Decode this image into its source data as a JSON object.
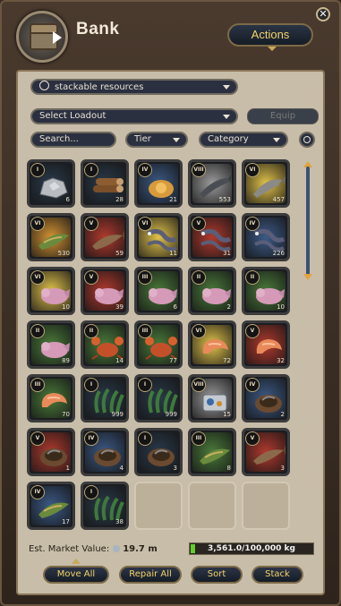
{
  "header": {
    "title": "Bank",
    "actions_label": "Actions",
    "close_label": "✕"
  },
  "filters": {
    "resource_dropdown": "stackable resources",
    "loadout_dropdown": "Select Loadout",
    "equip_label": "Equip",
    "search_value": "Search...",
    "tier_dropdown": "Tier",
    "category_dropdown": "Category"
  },
  "inventory": [
    {
      "tier": "I",
      "count": "6",
      "kind": "stone",
      "color": "#2a3a4a"
    },
    {
      "tier": "I",
      "count": "28",
      "kind": "log",
      "color": "#2a3a4a"
    },
    {
      "tier": "IV",
      "count": "21",
      "kind": "seed",
      "color": "#3c5a86"
    },
    {
      "tier": "VIII",
      "count": "553",
      "kind": "fish-dark",
      "color": "#9b9b9b"
    },
    {
      "tier": "VI",
      "count": "457",
      "kind": "fish-gray",
      "color": "#e0c24a"
    },
    {
      "tier": "VI",
      "count": "530",
      "kind": "fish-green",
      "color": "#d29233"
    },
    {
      "tier": "V",
      "count": "59",
      "kind": "fish-brown",
      "color": "#b03a2e"
    },
    {
      "tier": "VI",
      "count": "11",
      "kind": "eel",
      "color": "#e0c24a"
    },
    {
      "tier": "V",
      "count": "31",
      "kind": "eel",
      "color": "#b03a2e"
    },
    {
      "tier": "IV",
      "count": "226",
      "kind": "eel",
      "color": "#3c5a86"
    },
    {
      "tier": "VI",
      "count": "10",
      "kind": "axolotl",
      "color": "#e0c24a"
    },
    {
      "tier": "V",
      "count": "39",
      "kind": "axolotl",
      "color": "#b03a2e"
    },
    {
      "tier": "III",
      "count": "6",
      "kind": "axolotl",
      "color": "#4a7a3a"
    },
    {
      "tier": "II",
      "count": "2",
      "kind": "axolotl",
      "color": "#4a7a3a"
    },
    {
      "tier": "II",
      "count": "10",
      "kind": "axolotl",
      "color": "#4a7a3a"
    },
    {
      "tier": "II",
      "count": "89",
      "kind": "axolotl",
      "color": "#4a7a3a"
    },
    {
      "tier": "II",
      "count": "14",
      "kind": "crab",
      "color": "#4a7a3a"
    },
    {
      "tier": "III",
      "count": "77",
      "kind": "crab",
      "color": "#4a7a3a"
    },
    {
      "tier": "VI",
      "count": "72",
      "kind": "shrimp",
      "color": "#e0c24a"
    },
    {
      "tier": "V",
      "count": "32",
      "kind": "shrimp",
      "color": "#b03a2e"
    },
    {
      "tier": "III",
      "count": "70",
      "kind": "shrimp",
      "color": "#4a7a3a"
    },
    {
      "tier": "I",
      "count": "999",
      "kind": "weed",
      "color": "#2a3a4a"
    },
    {
      "tier": "I",
      "count": "999",
      "kind": "weed",
      "color": "#2a3a4a"
    },
    {
      "tier": "VIII",
      "count": "15",
      "kind": "box",
      "color": "#9b9b9b"
    },
    {
      "tier": "IV",
      "count": "2",
      "kind": "pot",
      "color": "#3c5a86"
    },
    {
      "tier": "V",
      "count": "1",
      "kind": "pot",
      "color": "#b03a2e"
    },
    {
      "tier": "IV",
      "count": "4",
      "kind": "pot",
      "color": "#3c5a86"
    },
    {
      "tier": "I",
      "count": "3",
      "kind": "pot",
      "color": "#2a3a4a"
    },
    {
      "tier": "III",
      "count": "8",
      "kind": "fish-green",
      "color": "#4a7a3a"
    },
    {
      "tier": "V",
      "count": "3",
      "kind": "fish-brown",
      "color": "#b03a2e"
    },
    {
      "tier": "IV",
      "count": "17",
      "kind": "fish-green",
      "color": "#3c5a86"
    },
    {
      "tier": "I",
      "count": "38",
      "kind": "weed",
      "color": "#2a3a4a"
    }
  ],
  "footer": {
    "market_label": "Est. Market Value:",
    "market_value": "19.7 m",
    "weight_text": "3,561.0/100,000 kg",
    "weight_fraction": 0.0356,
    "buttons": {
      "move_all": "Move All",
      "repair_all": "Repair All",
      "sort": "Sort",
      "stack": "Stack"
    }
  }
}
